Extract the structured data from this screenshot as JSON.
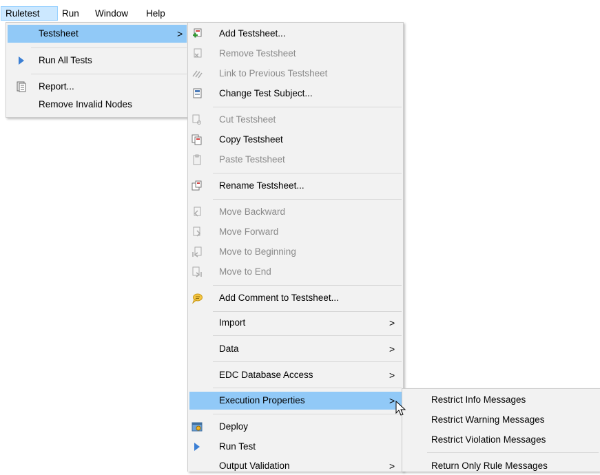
{
  "menubar": [
    "Ruletest",
    "Run",
    "Window",
    "Help"
  ],
  "ruletest_menu": {
    "testsheet": "Testsheet",
    "run_all_tests": "Run All Tests",
    "report": "Report...",
    "remove_invalid_nodes": "Remove Invalid Nodes"
  },
  "testsheet_menu": {
    "add_testsheet": "Add Testsheet...",
    "remove_testsheet": "Remove Testsheet",
    "link_previous": "Link to Previous Testsheet",
    "change_subject": "Change Test Subject...",
    "cut": "Cut Testsheet",
    "copy": "Copy Testsheet",
    "paste": "Paste Testsheet",
    "rename": "Rename Testsheet...",
    "move_backward": "Move Backward",
    "move_forward": "Move Forward",
    "move_beginning": "Move to Beginning",
    "move_end": "Move to End",
    "add_comment": "Add Comment to Testsheet...",
    "import": "Import",
    "data": "Data",
    "edc": "EDC Database Access",
    "execution_properties": "Execution Properties",
    "deploy": "Deploy",
    "run_test": "Run Test",
    "output_validation": "Output Validation"
  },
  "execution_menu": {
    "restrict_info": "Restrict Info Messages",
    "restrict_warning": "Restrict Warning Messages",
    "restrict_violation": "Restrict Violation Messages",
    "return_only_rule": "Return Only Rule Messages"
  },
  "arrow_glyph": ">",
  "colors": {
    "highlight": "#91c9f7",
    "menu_bg": "#f2f2f2",
    "disabled_text": "#8a8a8a",
    "run_icon": "#3b7fd4"
  }
}
